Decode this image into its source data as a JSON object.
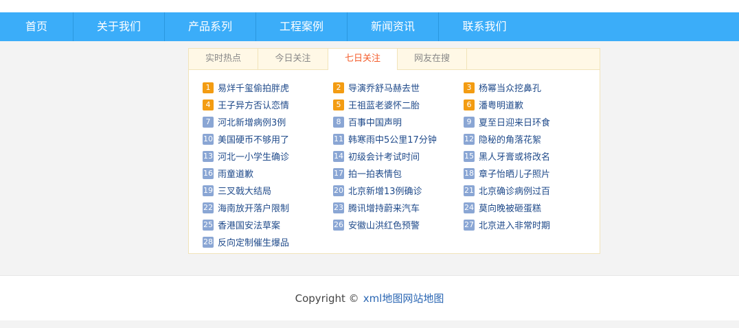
{
  "nav": {
    "items": [
      "首页",
      "关于我们",
      "产品系列",
      "工程案例",
      "新闻资讯",
      "联系我们"
    ]
  },
  "tabs": {
    "items": [
      "实时热点",
      "今日关注",
      "七日关注",
      "网友在搜"
    ],
    "active": "七日关注"
  },
  "hot_list": [
    {
      "num": "1",
      "title": "易烊千玺偷拍胖虎"
    },
    {
      "num": "2",
      "title": "导演乔舒马赫去世"
    },
    {
      "num": "3",
      "title": "杨幂当众挖鼻孔"
    },
    {
      "num": "4",
      "title": "王子异方否认恋情"
    },
    {
      "num": "5",
      "title": "王祖蓝老婆怀二胎"
    },
    {
      "num": "6",
      "title": "潘粤明道歉"
    },
    {
      "num": "7",
      "title": "河北新增病例3例"
    },
    {
      "num": "8",
      "title": "百事中国声明"
    },
    {
      "num": "9",
      "title": "夏至日迎来日环食"
    },
    {
      "num": "10",
      "title": "美国硬币不够用了"
    },
    {
      "num": "11",
      "title": "韩寒雨中5公里17分钟"
    },
    {
      "num": "12",
      "title": "隐秘的角落花絮"
    },
    {
      "num": "13",
      "title": "河北一小学生确诊"
    },
    {
      "num": "14",
      "title": "初级会计考试时间"
    },
    {
      "num": "15",
      "title": "黑人牙膏或将改名"
    },
    {
      "num": "16",
      "title": "雨童道歉"
    },
    {
      "num": "17",
      "title": "拍一拍表情包"
    },
    {
      "num": "18",
      "title": "章子怡晒儿子照片"
    },
    {
      "num": "19",
      "title": "三叉戟大结局"
    },
    {
      "num": "20",
      "title": "北京新增13例确诊"
    },
    {
      "num": "21",
      "title": "北京确诊病例过百"
    },
    {
      "num": "22",
      "title": "海南放开落户限制"
    },
    {
      "num": "23",
      "title": "腾讯增持蔚来汽车"
    },
    {
      "num": "24",
      "title": "莫向晚被砸蛋糕"
    },
    {
      "num": "25",
      "title": "香港国安法草案"
    },
    {
      "num": "26",
      "title": "安徽山洪红色预警"
    },
    {
      "num": "27",
      "title": "北京进入非常时期"
    },
    {
      "num": "28",
      "title": "反向定制催生爆品"
    }
  ],
  "footer": {
    "copyright": "Copyright ©",
    "link": "xml地图网站地图"
  },
  "colors": {
    "nav_bg": "#3badf9",
    "hot_badge": "#f39c12",
    "normal_badge": "#8aa6d4",
    "active_tab": "#f45b2a"
  }
}
